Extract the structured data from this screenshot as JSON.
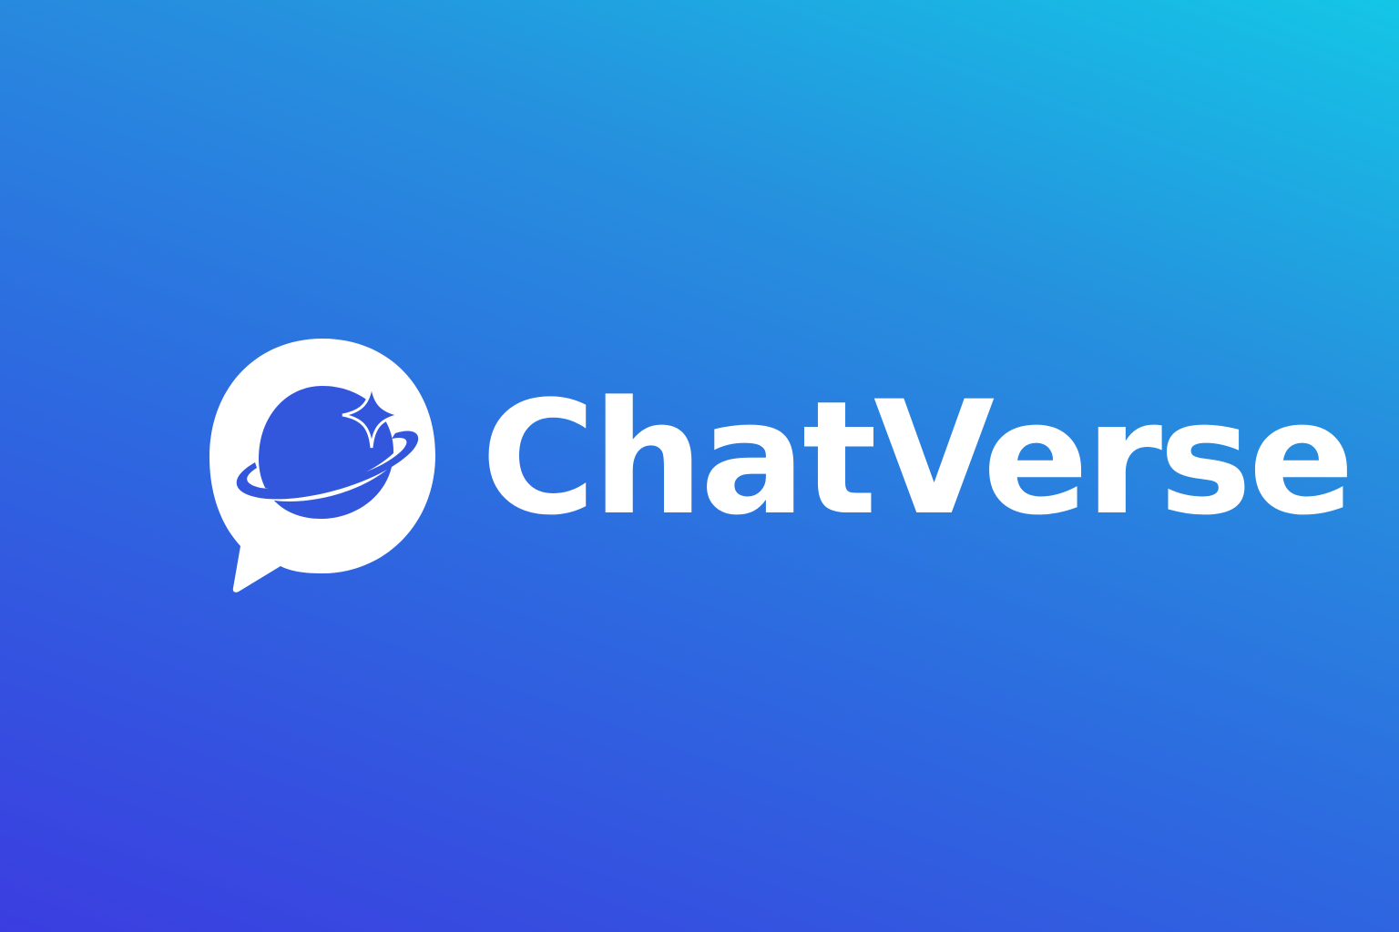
{
  "brand": {
    "name": "ChatVerse",
    "logo_icon": "chat-bubble-planet-sparkle-icon"
  },
  "colors": {
    "gradient_start": "#3b3de0",
    "gradient_end": "#14c6e6",
    "logo_foreground": "#ffffff",
    "planet_fill": "#3357dc"
  }
}
